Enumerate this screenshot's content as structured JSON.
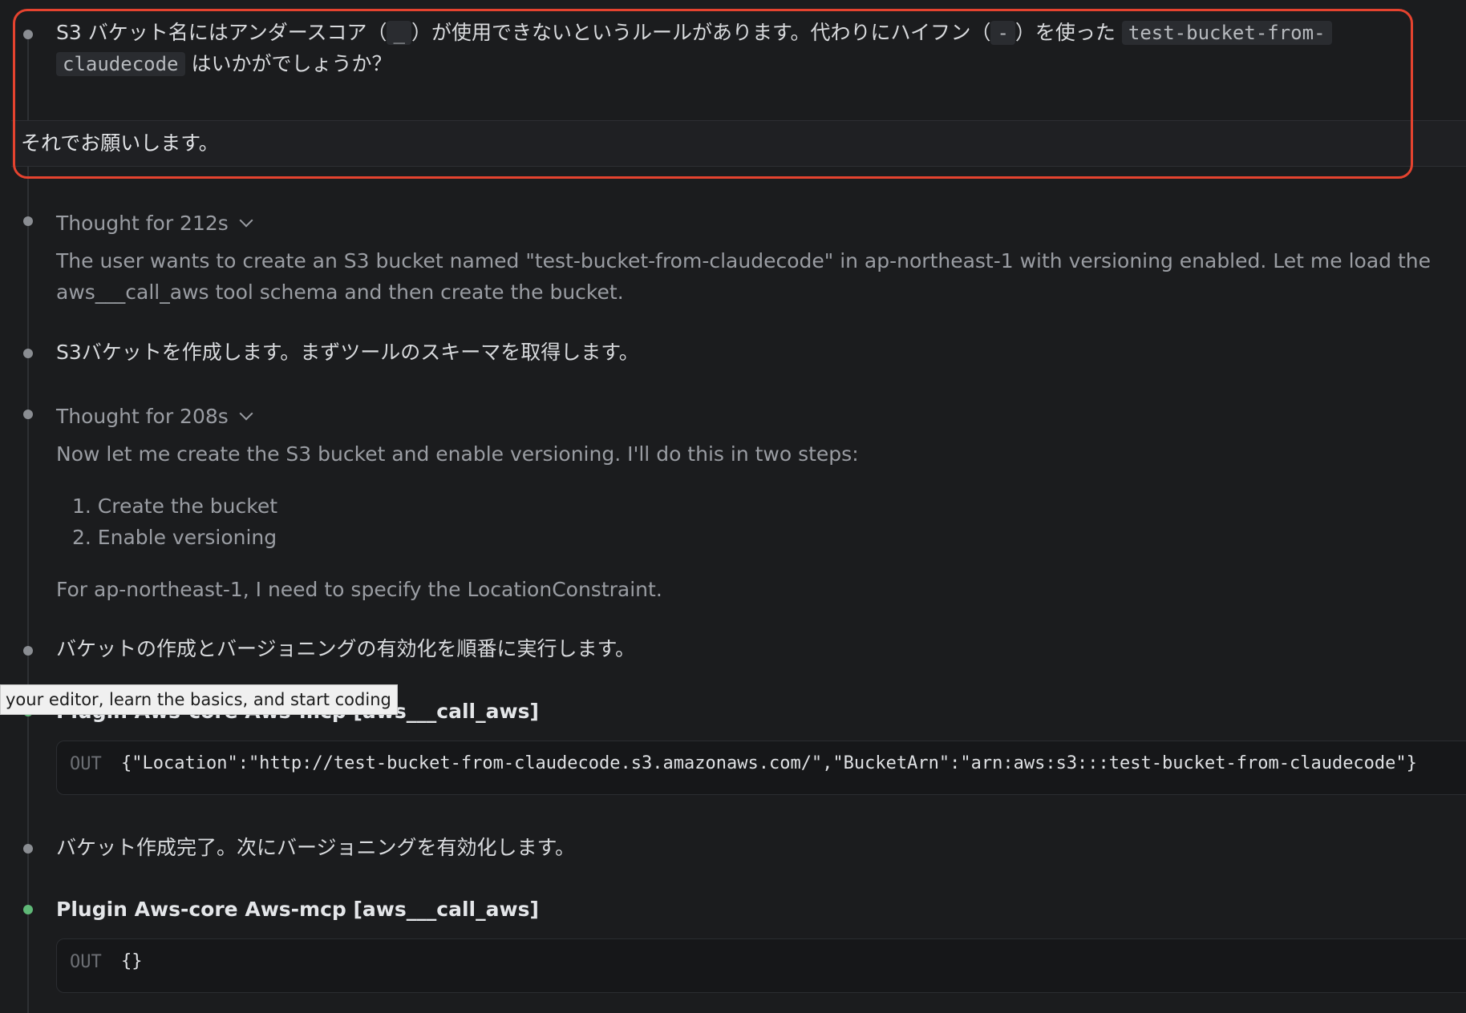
{
  "assistant_note": {
    "part1": "S3 バケット名にはアンダースコア（",
    "underscore": "_",
    "part2": "）が使用できないというルールがあります。代わりにハイフン（",
    "hyphen": "-",
    "part3": "）を使った",
    "bucket_code_line1": "test-bucket-from-",
    "bucket_code_line2": "claudecode",
    "part4": "はいかがでしょうか？"
  },
  "user_message": "それでお願いします。",
  "thought1": {
    "label": "Thought for 212s",
    "line1": "The user wants to create an S3 bucket named \"test-bucket-from-claudecode\" in ap-northeast-1 with versioning enabled. Let me load the",
    "line2": "aws___call_aws tool schema and then create the bucket."
  },
  "msg_schema": "S3バケットを作成します。まずツールのスキーマを取得します。",
  "thought2": {
    "label": "Thought for 208s",
    "intro": "Now let me create the S3 bucket and enable versioning. I'll do this in two steps:",
    "steps": [
      "1. Create the bucket",
      "2. Enable versioning"
    ],
    "note": "For ap-northeast-1, I need to specify the LocationConstraint."
  },
  "msg_sequence": "バケットの作成とバージョニングの有効化を順番に実行します。",
  "tool1": {
    "title": "Plugin Aws-core Aws-mcp [aws___call_aws]",
    "out_label": "OUT",
    "out_value": "{\"Location\":\"http://test-bucket-from-claudecode.s3.amazonaws.com/\",\"BucketArn\":\"arn:aws:s3:::test-bucket-from-claudecode\"}"
  },
  "msg_created": "バケット作成完了。次にバージョニングを有効化します。",
  "tool2": {
    "title": "Plugin Aws-core Aws-mcp [aws___call_aws]",
    "out_label": "OUT",
    "out_value": "{}"
  },
  "tooltip": "your editor, learn the basics, and start coding",
  "colors": {
    "background": "#1b1c1e",
    "highlight": "#e5432f",
    "success_dot": "#5fb877"
  }
}
